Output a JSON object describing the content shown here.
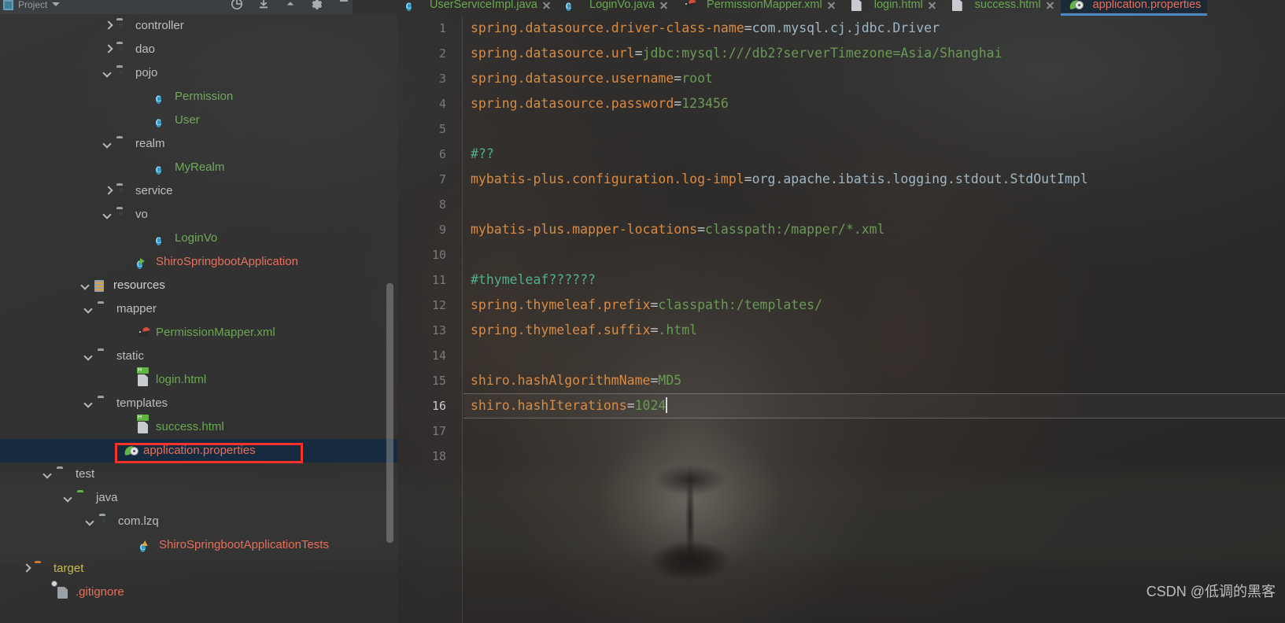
{
  "window": {
    "tool_window_title": "Project",
    "watermark": "CSDN @低调的黑客"
  },
  "toolbar": {
    "icons": [
      "locate-target-icon",
      "collapse-all-icon",
      "expand-all-icon",
      "settings-gear-icon",
      "hide-window-icon"
    ]
  },
  "colors": {
    "accent_blue": "#4a88c7",
    "selection_bg": "#132a40",
    "annotation_red": "#f8312b",
    "class_green": "#72a95c",
    "file_salmon": "#e8705a",
    "key_orange": "#d98b42",
    "value_green": "#6a9a55",
    "comment_teal": "#4fb08a"
  },
  "tree": {
    "scrollbar": true,
    "items": [
      {
        "label": "controller",
        "indent": 146,
        "arrow": "right",
        "icon": "package-folder-icon",
        "color": "c-default"
      },
      {
        "label": "dao",
        "indent": 146,
        "arrow": "right",
        "icon": "package-folder-icon",
        "color": "c-default"
      },
      {
        "label": "pojo",
        "indent": 146,
        "arrow": "down",
        "icon": "package-folder-icon",
        "color": "c-default"
      },
      {
        "label": "Permission",
        "indent": 196,
        "arrow": "none",
        "icon": "java-class-icon",
        "color": "c-class"
      },
      {
        "label": "User",
        "indent": 196,
        "arrow": "none",
        "icon": "java-class-icon",
        "color": "c-class"
      },
      {
        "label": "realm",
        "indent": 146,
        "arrow": "down",
        "icon": "folder-icon",
        "color": "c-default"
      },
      {
        "label": "MyRealm",
        "indent": 196,
        "arrow": "none",
        "icon": "java-class-icon",
        "color": "c-class"
      },
      {
        "label": "service",
        "indent": 146,
        "arrow": "right",
        "icon": "package-folder-icon",
        "color": "c-default"
      },
      {
        "label": "vo",
        "indent": 146,
        "arrow": "down",
        "icon": "package-folder-icon",
        "color": "c-default"
      },
      {
        "label": "LoginVo",
        "indent": 196,
        "arrow": "none",
        "icon": "java-class-icon",
        "color": "c-class"
      },
      {
        "label": "ShiroSpringbootApplication",
        "indent": 172,
        "arrow": "none",
        "icon": "spring-boot-run-icon",
        "color": "c-salmon"
      },
      {
        "label": "resources",
        "indent": 118,
        "arrow": "down",
        "icon": "resources-root-icon",
        "color": "c-white"
      },
      {
        "label": "mapper",
        "indent": 122,
        "arrow": "down",
        "icon": "folder-icon",
        "color": "c-default"
      },
      {
        "label": "PermissionMapper.xml",
        "indent": 172,
        "arrow": "none",
        "icon": "mybatis-mapper-icon",
        "color": "c-green"
      },
      {
        "label": "static",
        "indent": 122,
        "arrow": "down",
        "icon": "folder-icon",
        "color": "c-default"
      },
      {
        "label": "login.html",
        "indent": 172,
        "arrow": "none",
        "icon": "html-file-icon",
        "color": "c-green"
      },
      {
        "label": "templates",
        "indent": 122,
        "arrow": "down",
        "icon": "folder-icon",
        "color": "c-default"
      },
      {
        "label": "success.html",
        "indent": 172,
        "arrow": "none",
        "icon": "html-file-icon",
        "color": "c-green"
      },
      {
        "label": "application.properties",
        "indent": 156,
        "arrow": "none",
        "icon": "spring-properties-icon",
        "color": "c-salmon",
        "selected": true,
        "annotated": true
      },
      {
        "label": "test",
        "indent": 70,
        "arrow": "down",
        "icon": "folder-icon",
        "color": "c-default"
      },
      {
        "label": "java",
        "indent": 96,
        "arrow": "down",
        "icon": "source-folder-icon",
        "color": "c-default"
      },
      {
        "label": "com.lzq",
        "indent": 124,
        "arrow": "down",
        "icon": "package-folder-icon",
        "color": "c-default"
      },
      {
        "label": "ShiroSpringbootApplicationTests",
        "indent": 176,
        "arrow": "none",
        "icon": "java-test-class-icon",
        "color": "c-salmon"
      },
      {
        "label": "target",
        "indent": 42,
        "arrow": "right",
        "icon": "excluded-folder-icon",
        "color": "c-olive"
      },
      {
        "label": ".gitignore",
        "indent": 70,
        "arrow": "none",
        "icon": "gitignore-file-icon",
        "color": "c-salmon"
      }
    ]
  },
  "tabs": [
    {
      "label": "UserServiceImpl.java",
      "icon": "java-class-icon",
      "active": false,
      "closable": true
    },
    {
      "label": "LoginVo.java",
      "icon": "java-class-icon",
      "active": false,
      "closable": true
    },
    {
      "label": "PermissionMapper.xml",
      "icon": "mybatis-mapper-icon",
      "active": false,
      "closable": true
    },
    {
      "label": "login.html",
      "icon": "html-file-icon",
      "active": false,
      "closable": true
    },
    {
      "label": "success.html",
      "icon": "html-file-icon",
      "active": false,
      "closable": true
    },
    {
      "label": "application.properties",
      "icon": "spring-properties-icon",
      "active": true,
      "closable": false
    }
  ],
  "editor": {
    "file": "application.properties",
    "caret_line": 16,
    "total_visible_lines": 18,
    "lines": [
      {
        "n": 1,
        "type": "prop",
        "key": "spring.datasource.driver-class-name",
        "value": "com.mysql.cj.jdbc.Driver",
        "value_style": "vb"
      },
      {
        "n": 2,
        "type": "prop",
        "key": "spring.datasource.url",
        "value": "jdbc:mysql:///db2?serverTimezone=Asia/Shanghai",
        "value_style": "v"
      },
      {
        "n": 3,
        "type": "prop",
        "key": "spring.datasource.username",
        "value": "root",
        "value_style": "v"
      },
      {
        "n": 4,
        "type": "prop",
        "key": "spring.datasource.password",
        "value": "123456",
        "value_style": "v"
      },
      {
        "n": 5,
        "type": "blank"
      },
      {
        "n": 6,
        "type": "comment",
        "text": "#??"
      },
      {
        "n": 7,
        "type": "prop",
        "key": "mybatis-plus.configuration.log-impl",
        "value": "org.apache.ibatis.logging.stdout.StdOutImpl",
        "value_style": "vb"
      },
      {
        "n": 8,
        "type": "blank"
      },
      {
        "n": 9,
        "type": "prop",
        "key": "mybatis-plus.mapper-locations",
        "value": "classpath:/mapper/*.xml",
        "value_style": "v"
      },
      {
        "n": 10,
        "type": "blank"
      },
      {
        "n": 11,
        "type": "comment",
        "text": "#thymeleaf??????"
      },
      {
        "n": 12,
        "type": "prop",
        "key": "spring.thymeleaf.prefix",
        "value": "classpath:/templates/",
        "value_style": "v"
      },
      {
        "n": 13,
        "type": "prop",
        "key": "spring.thymeleaf.suffix",
        "value": ".html",
        "value_style": "v"
      },
      {
        "n": 14,
        "type": "blank"
      },
      {
        "n": 15,
        "type": "prop",
        "key": "shiro.hashAlgorithmName",
        "value": "MD5",
        "value_style": "v"
      },
      {
        "n": 16,
        "type": "prop",
        "key": "shiro.hashIterations",
        "value": "1024",
        "value_style": "v",
        "caret": true
      },
      {
        "n": 17,
        "type": "blank"
      },
      {
        "n": 18,
        "type": "blank"
      }
    ]
  }
}
